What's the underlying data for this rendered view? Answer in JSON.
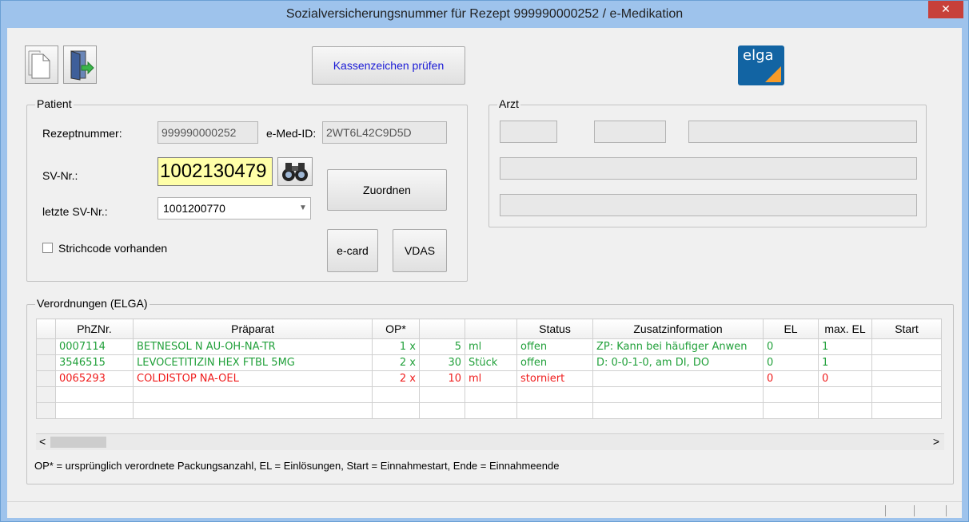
{
  "window": {
    "title": "Sozialversicherungsnummer für Rezept 999990000252 / e-Medikation",
    "close_label": "✕"
  },
  "toolbar": {
    "new_doc_icon": "document-icon",
    "exit_icon": "exit-door-icon",
    "kassen_label": "Kassenzeichen prüfen",
    "logo_text": "elga"
  },
  "patient": {
    "title": "Patient",
    "rezept_label": "Rezeptnummer:",
    "rezept_value": "999990000252",
    "emed_label": "e-Med-ID:",
    "emed_value": "2WT6L42C9D5D",
    "sv_label": "SV-Nr.:",
    "sv_value": "1002130479",
    "last_sv_label": "letzte SV-Nr.:",
    "last_sv_value": "1001200770",
    "barcode_label": "Strichcode vorhanden",
    "zuordnen_label": "Zuordnen",
    "ecard_label": "e-card",
    "vdas_label": "VDAS"
  },
  "arzt": {
    "title": "Arzt"
  },
  "verordnungen": {
    "title": "Verordnungen (ELGA)",
    "columns": [
      "PhZNr.",
      "Präparat",
      "OP*",
      "",
      "",
      "Status",
      "Zusatzinformation",
      "EL",
      "max. EL",
      "Start"
    ],
    "rows": [
      {
        "phz": "0007114",
        "praeparat": "BETNESOL N AU-OH-NA-TR",
        "op": "1 x",
        "menge": "5",
        "einheit": "ml",
        "status": "offen",
        "zusatz": "ZP: Kann bei häufiger Anwen",
        "el": "0",
        "maxel": "1",
        "start": "",
        "color": "#21a03a"
      },
      {
        "phz": "3546515",
        "praeparat": "LEVOCETITIZIN HEX FTBL 5MG",
        "op": "2 x",
        "menge": "30",
        "einheit": "Stück",
        "status": "offen",
        "zusatz": "D: 0-0-1-0, am DI, DO",
        "el": "0",
        "maxel": "1",
        "start": "",
        "color": "#21a03a"
      },
      {
        "phz": "0065293",
        "praeparat": "COLDISTOP NA-OEL",
        "op": "2 x",
        "menge": "10",
        "einheit": "ml",
        "status": "storniert",
        "zusatz": "",
        "el": "0",
        "maxel": "0",
        "start": "",
        "color": "#ef1c1c"
      }
    ],
    "legend": "OP* = ursprünglich verordnete Packungsanzahl, EL = Einlösungen, Start = Einnahmestart, Ende = Einnahmeende"
  },
  "scroll": {
    "left_arrow": "<",
    "right_arrow": ">"
  }
}
